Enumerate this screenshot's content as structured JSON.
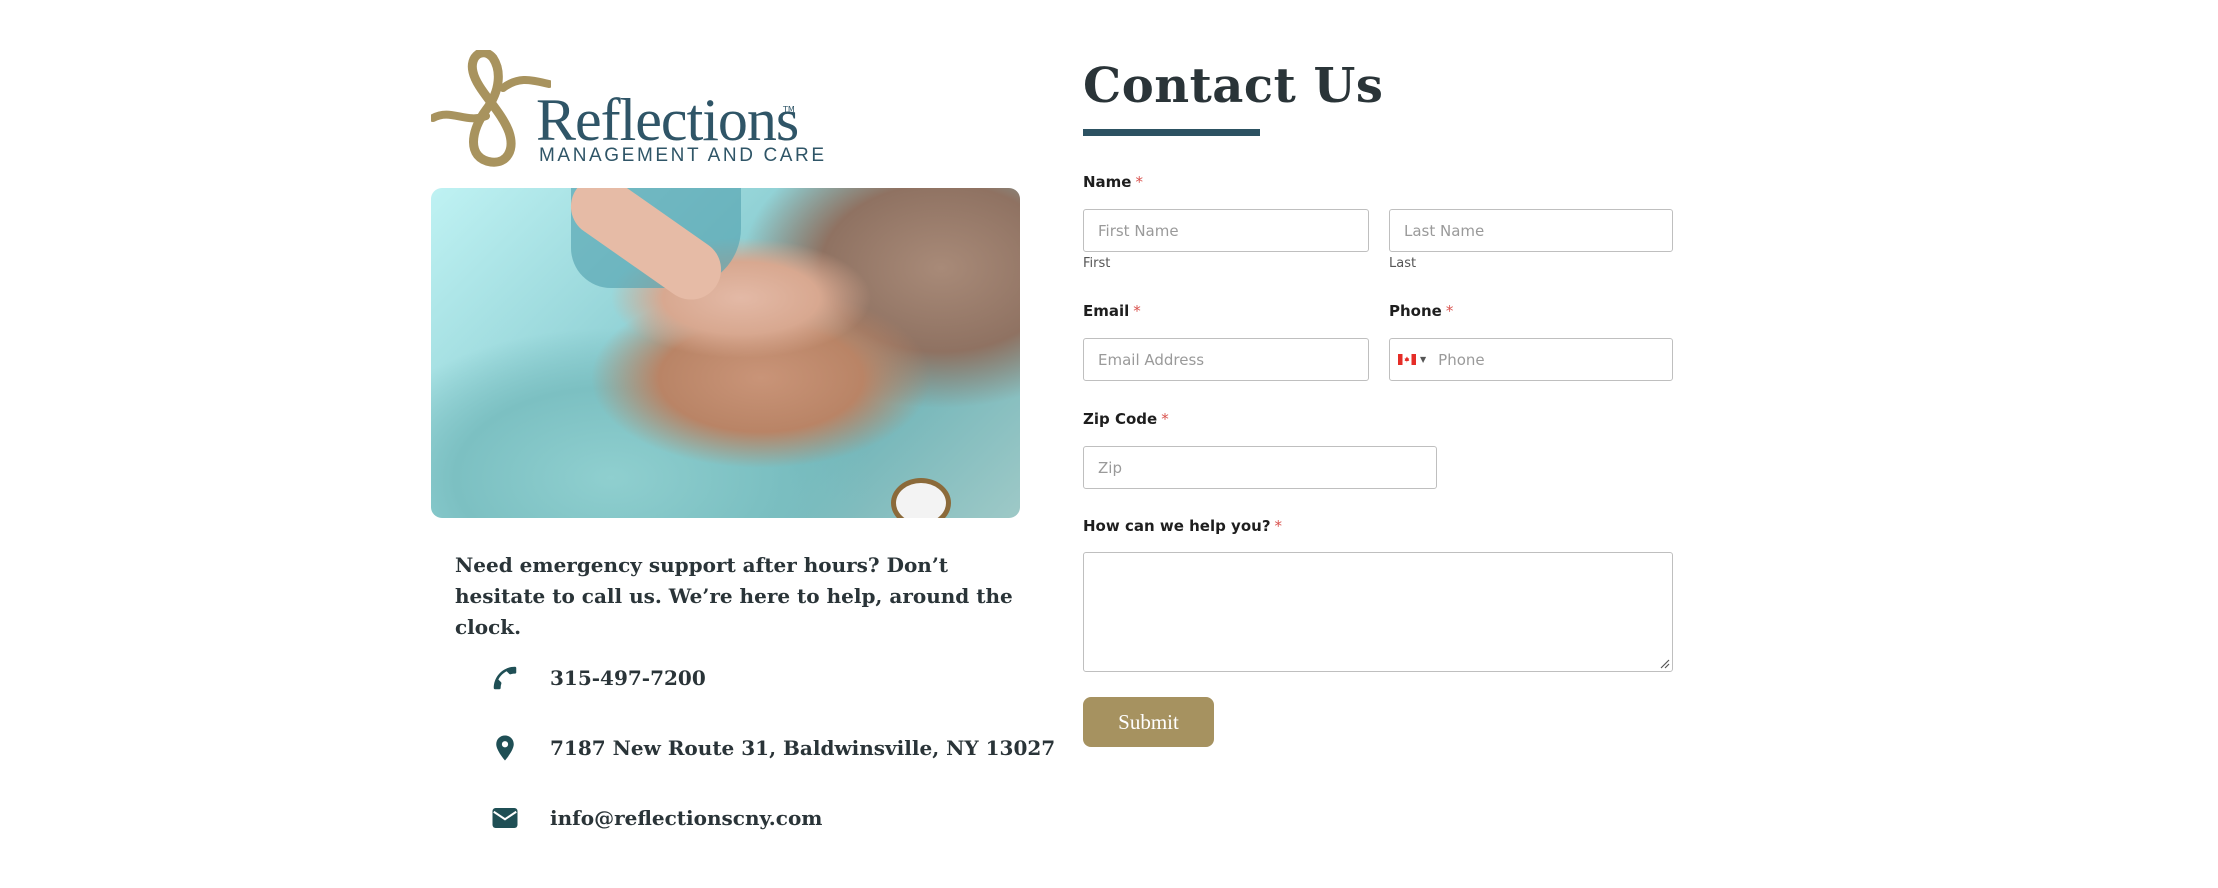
{
  "brand": {
    "name": "Reflections",
    "tagline": "MANAGEMENT AND CARE",
    "trademark": "TM",
    "gold": "#a8935e",
    "teal": "#2f5567"
  },
  "left": {
    "message": "Need emergency support after hours? Don’t hesitate to call us. We’re here to help, around the clock.",
    "contacts": [
      {
        "icon": "phone-icon",
        "text": "315-497-7200"
      },
      {
        "icon": "map-pin-icon",
        "text": "7187 New Route 31, Baldwinsville, NY 13027"
      },
      {
        "icon": "envelope-icon",
        "text": "info@reflectionscny.com"
      }
    ]
  },
  "form": {
    "title": "Contact Us",
    "required_mark": "*",
    "name": {
      "label": "Name",
      "first_placeholder": "First Name",
      "first_sublabel": "First",
      "last_placeholder": "Last Name",
      "last_sublabel": "Last"
    },
    "email": {
      "label": "Email",
      "placeholder": "Email Address"
    },
    "phone": {
      "label": "Phone",
      "placeholder": "Phone",
      "country": "Canada"
    },
    "zip": {
      "label": "Zip Code",
      "placeholder": "Zip"
    },
    "help": {
      "label": "How can we help you?",
      "value": ""
    },
    "submit_label": "Submit",
    "accent": "#a69260"
  }
}
